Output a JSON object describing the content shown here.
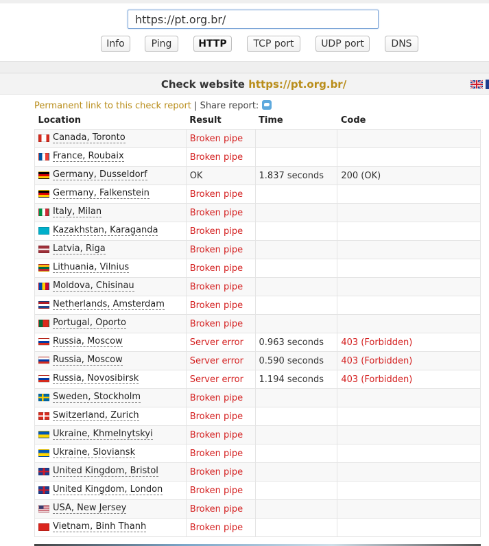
{
  "search": {
    "value": "https://pt.org.br/"
  },
  "tabs": [
    {
      "label": "Info"
    },
    {
      "label": "Ping"
    },
    {
      "label": "HTTP"
    },
    {
      "label": "TCP port"
    },
    {
      "label": "UDP port"
    },
    {
      "label": "DNS"
    }
  ],
  "header": {
    "prefix": "Check website",
    "url": "https://pt.org.br/"
  },
  "links": {
    "permanent": "Permanent link to this check report",
    "separator": "|",
    "share": "Share report:"
  },
  "columns": [
    "Location",
    "Result",
    "Time",
    "Code"
  ],
  "rows": [
    {
      "flag": "ca",
      "location": "Canada, Toronto",
      "result": "Broken pipe",
      "time": "",
      "code": ""
    },
    {
      "flag": "fr",
      "location": "France, Roubaix",
      "result": "Broken pipe",
      "time": "",
      "code": ""
    },
    {
      "flag": "de",
      "location": "Germany, Dusseldorf",
      "result": "OK",
      "time": "1.837 seconds",
      "code": "200 (OK)"
    },
    {
      "flag": "de",
      "location": "Germany, Falkenstein",
      "result": "Broken pipe",
      "time": "",
      "code": ""
    },
    {
      "flag": "it",
      "location": "Italy, Milan",
      "result": "Broken pipe",
      "time": "",
      "code": ""
    },
    {
      "flag": "kz",
      "location": "Kazakhstan, Karaganda",
      "result": "Broken pipe",
      "time": "",
      "code": ""
    },
    {
      "flag": "lv",
      "location": "Latvia, Riga",
      "result": "Broken pipe",
      "time": "",
      "code": ""
    },
    {
      "flag": "lt",
      "location": "Lithuania, Vilnius",
      "result": "Broken pipe",
      "time": "",
      "code": ""
    },
    {
      "flag": "md",
      "location": "Moldova, Chisinau",
      "result": "Broken pipe",
      "time": "",
      "code": ""
    },
    {
      "flag": "nl",
      "location": "Netherlands, Amsterdam",
      "result": "Broken pipe",
      "time": "",
      "code": ""
    },
    {
      "flag": "pt",
      "location": "Portugal, Oporto",
      "result": "Broken pipe",
      "time": "",
      "code": ""
    },
    {
      "flag": "ru",
      "location": "Russia, Moscow",
      "result": "Server error",
      "time": "0.963 seconds",
      "code": "403 (Forbidden)"
    },
    {
      "flag": "ru",
      "location": "Russia, Moscow",
      "result": "Server error",
      "time": "0.590 seconds",
      "code": "403 (Forbidden)"
    },
    {
      "flag": "ru",
      "location": "Russia, Novosibirsk",
      "result": "Server error",
      "time": "1.194 seconds",
      "code": "403 (Forbidden)"
    },
    {
      "flag": "se",
      "location": "Sweden, Stockholm",
      "result": "Broken pipe",
      "time": "",
      "code": ""
    },
    {
      "flag": "ch",
      "location": "Switzerland, Zurich",
      "result": "Broken pipe",
      "time": "",
      "code": ""
    },
    {
      "flag": "ua",
      "location": "Ukraine, Khmelnytskyi",
      "result": "Broken pipe",
      "time": "",
      "code": ""
    },
    {
      "flag": "ua",
      "location": "Ukraine, Sloviansk",
      "result": "Broken pipe",
      "time": "",
      "code": ""
    },
    {
      "flag": "gb",
      "location": "United Kingdom, Bristol",
      "result": "Broken pipe",
      "time": "",
      "code": ""
    },
    {
      "flag": "gb",
      "location": "United Kingdom, London",
      "result": "Broken pipe",
      "time": "",
      "code": ""
    },
    {
      "flag": "us",
      "location": "USA, New Jersey",
      "result": "Broken pipe",
      "time": "",
      "code": ""
    },
    {
      "flag": "vn",
      "location": "Vietnam, Binh Thanh",
      "result": "Broken pipe",
      "time": "",
      "code": ""
    }
  ],
  "colors": {
    "link": "#b98d1a",
    "error": "#d42020",
    "ok": "#333333"
  }
}
